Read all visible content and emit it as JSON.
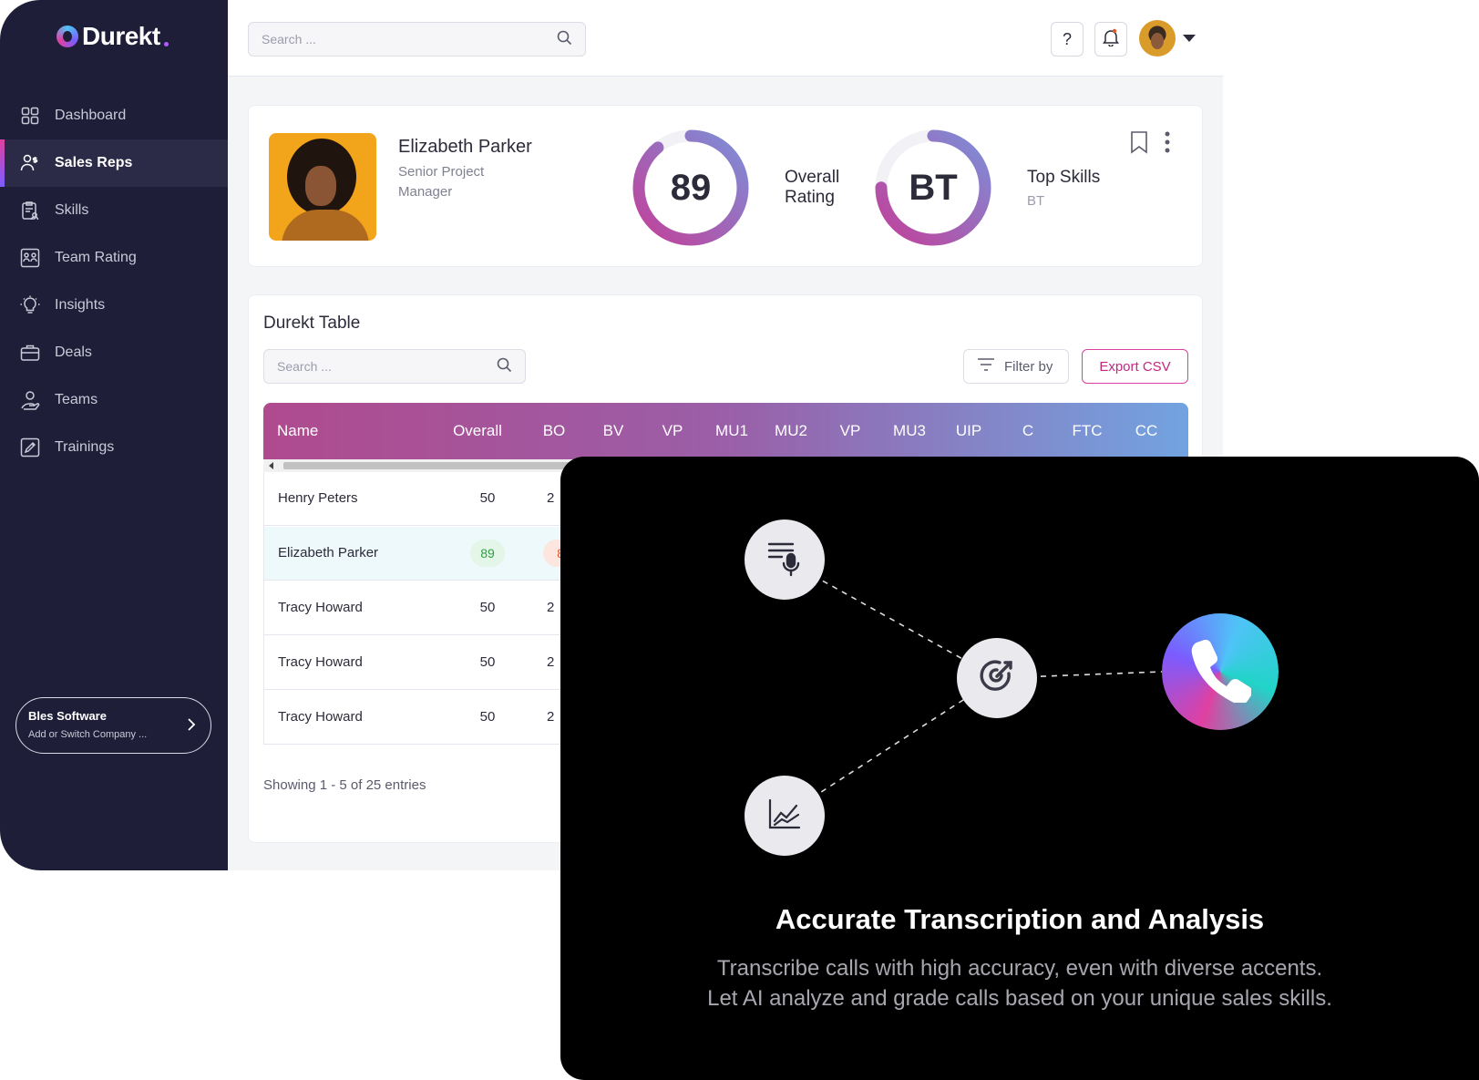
{
  "app": {
    "brand": "Durekt",
    "nav": [
      {
        "label": "Dashboard",
        "icon": "grid-icon"
      },
      {
        "label": "Sales Reps",
        "icon": "users-dollar-icon",
        "active": true
      },
      {
        "label": "Skills",
        "icon": "clipboard-user-icon"
      },
      {
        "label": "Team Rating",
        "icon": "team-rating-icon"
      },
      {
        "label": "Insights",
        "icon": "lightbulb-icon"
      },
      {
        "label": "Deals",
        "icon": "briefcase-icon"
      },
      {
        "label": "Teams",
        "icon": "user-hand-icon"
      },
      {
        "label": "Trainings",
        "icon": "certificate-icon"
      }
    ],
    "company": {
      "name": "Bles Software",
      "subtitle": "Add or Switch Company ..."
    }
  },
  "topbar": {
    "search_placeholder": "Search ...",
    "help_label": "?"
  },
  "profile": {
    "name": "Elizabeth Parker",
    "role": "Senior Project Manager",
    "overall": {
      "value": "89",
      "label": "Overall Rating",
      "fraction": 0.89
    },
    "skills": {
      "value": "BT",
      "label": "Top Skills",
      "sub": "BT",
      "fraction": 0.75
    }
  },
  "table": {
    "title": "Durekt Table",
    "search_placeholder": "Search ...",
    "filter_label": "Filter by",
    "export_label": "Export CSV",
    "columns": [
      "Name",
      "Overall",
      "BO",
      "BV",
      "VP",
      "MU1",
      "MU2",
      "VP",
      "MU3",
      "UIP",
      "C",
      "FTC",
      "CC"
    ],
    "rows": [
      {
        "name": "Henry Peters",
        "overall": "50",
        "bo": "2"
      },
      {
        "name": "Elizabeth Parker",
        "overall": "89",
        "bo": "8"
      },
      {
        "name": "Tracy Howard",
        "overall": "50",
        "bo": "2"
      },
      {
        "name": "Tracy Howard",
        "overall": "50",
        "bo": "2"
      },
      {
        "name": "Tracy Howard",
        "overall": "50",
        "bo": "2"
      }
    ],
    "showing": "Showing 1 - 5 of 25 entries"
  },
  "overlay": {
    "title": "Accurate Transcription and Analysis",
    "desc_line1": "Transcribe calls with high accuracy, even with diverse accents.",
    "desc_line2": "Let AI analyze and grade calls based on your unique sales skills.",
    "nodes": [
      "transcript-mic-icon",
      "target-icon",
      "phone-icon",
      "line-chart-icon"
    ]
  },
  "colors": {
    "sidebar": "#1e1e38",
    "accent_pink": "#e040a0",
    "accent_purple": "#7b5cff",
    "accent_blue": "#4fc3f7"
  }
}
